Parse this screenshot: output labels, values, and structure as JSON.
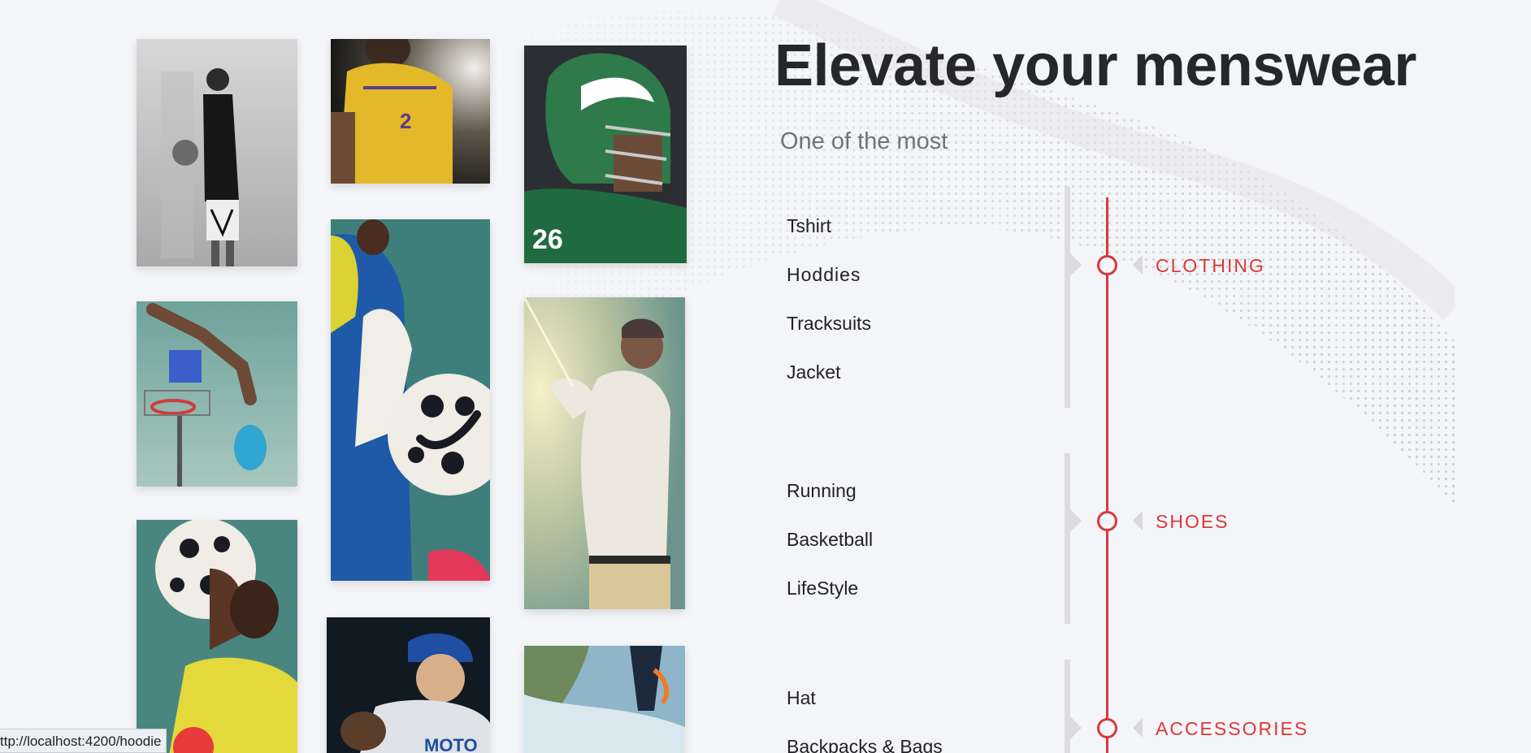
{
  "hero": {
    "title": "Elevate your menswear",
    "subtitle": "One of the most"
  },
  "photos": [
    {
      "name": "photo-hoodie-player",
      "subject": "player in black hoodie holding basketball"
    },
    {
      "name": "photo-lakers-player",
      "subject": "basketball player in yellow jersey"
    },
    {
      "name": "photo-football-helmet",
      "subject": "football player in green helmet"
    },
    {
      "name": "photo-dunk",
      "subject": "player dunking at outdoor hoop"
    },
    {
      "name": "photo-soccer-ball",
      "subject": "soccer player with ball"
    },
    {
      "name": "photo-baseball-batter",
      "subject": "baseball batter swinging"
    },
    {
      "name": "photo-soccer-goalkeeper",
      "subject": "player holding soccer ball"
    },
    {
      "name": "photo-baseball-pitcher",
      "subject": "baseball pitcher in blue cap"
    },
    {
      "name": "photo-coast",
      "subject": "coastline scene"
    }
  ],
  "categories": [
    {
      "label": "CLOTHING",
      "items": [
        "Tshirt",
        "Hoddies",
        "Tracksuits",
        "Jacket"
      ]
    },
    {
      "label": "SHOES",
      "items": [
        "Running",
        "Basketball",
        "LifeStyle"
      ]
    },
    {
      "label": "ACCESSORIES",
      "items": [
        "Hat",
        "Backpacks & Bags"
      ]
    }
  ],
  "status_bar": {
    "url": "ttp://localhost:4200/hoodie"
  },
  "colors": {
    "accent": "#d9383a",
    "background": "#f4f5f8",
    "title": "#26272b",
    "subtitle": "#6f7379"
  }
}
